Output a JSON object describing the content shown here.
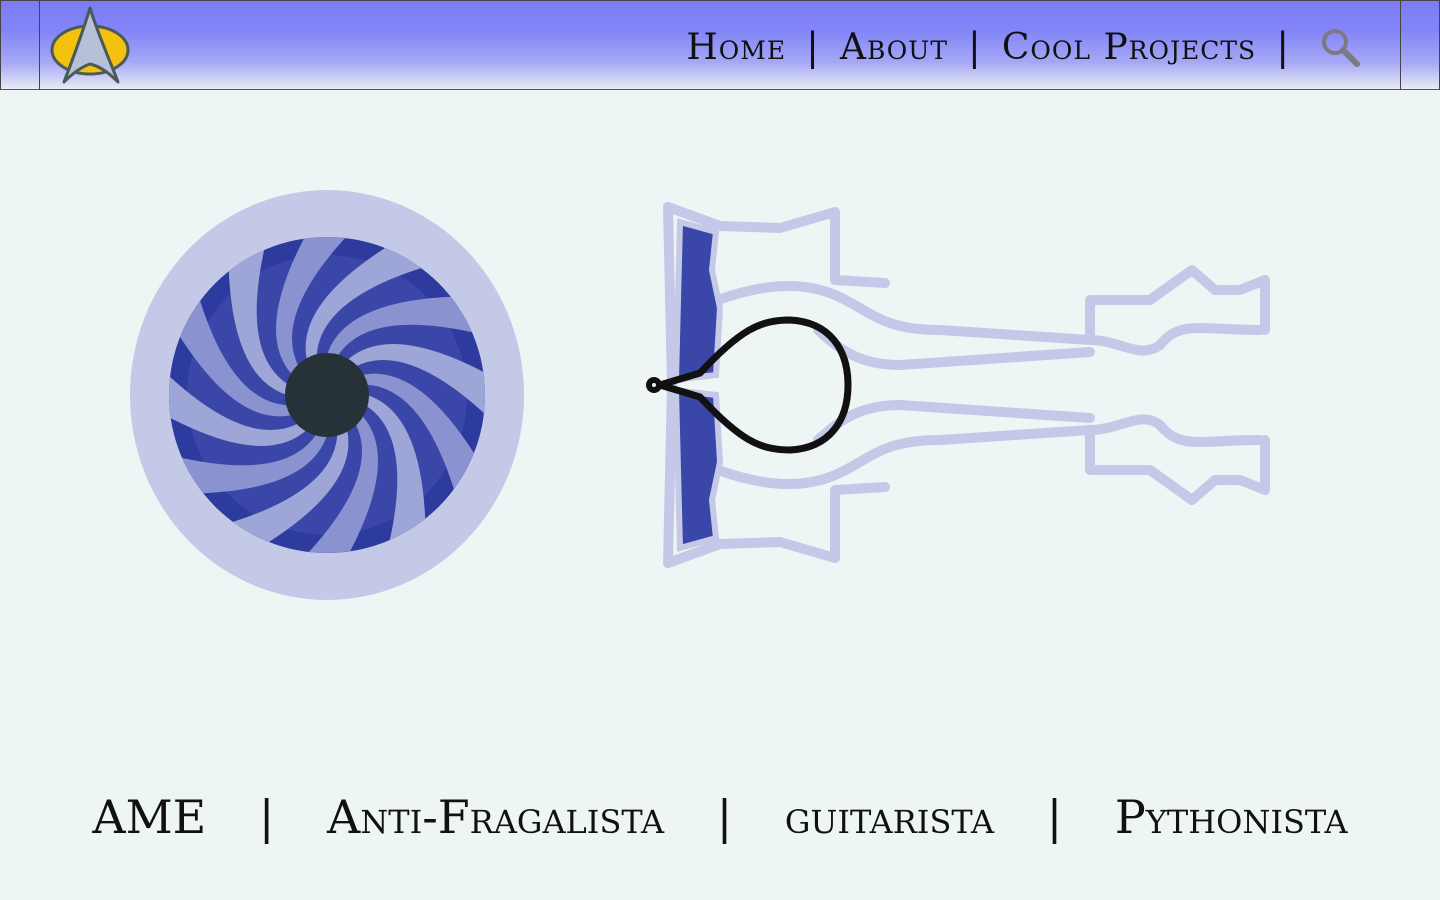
{
  "header": {
    "logo_icon": "starfleet-delta-icon",
    "nav": [
      {
        "label": "Home"
      },
      {
        "label": "About"
      },
      {
        "label": "Cool Projects"
      }
    ],
    "separator": "|",
    "search_icon": "search-icon"
  },
  "hero": {
    "fan_icon": "turbofan-front-icon",
    "engine_icon": "jet-engine-cutaway-icon"
  },
  "tagline": {
    "items": [
      "AME",
      "Anti-Fragalista",
      "guitarista",
      "Pythonista"
    ],
    "separator": "|"
  },
  "colors": {
    "header_top": "#7b7cf6",
    "background": "#eef5f5",
    "accent_blue": "#3a47a8",
    "light_blue": "#c5c9e8"
  }
}
